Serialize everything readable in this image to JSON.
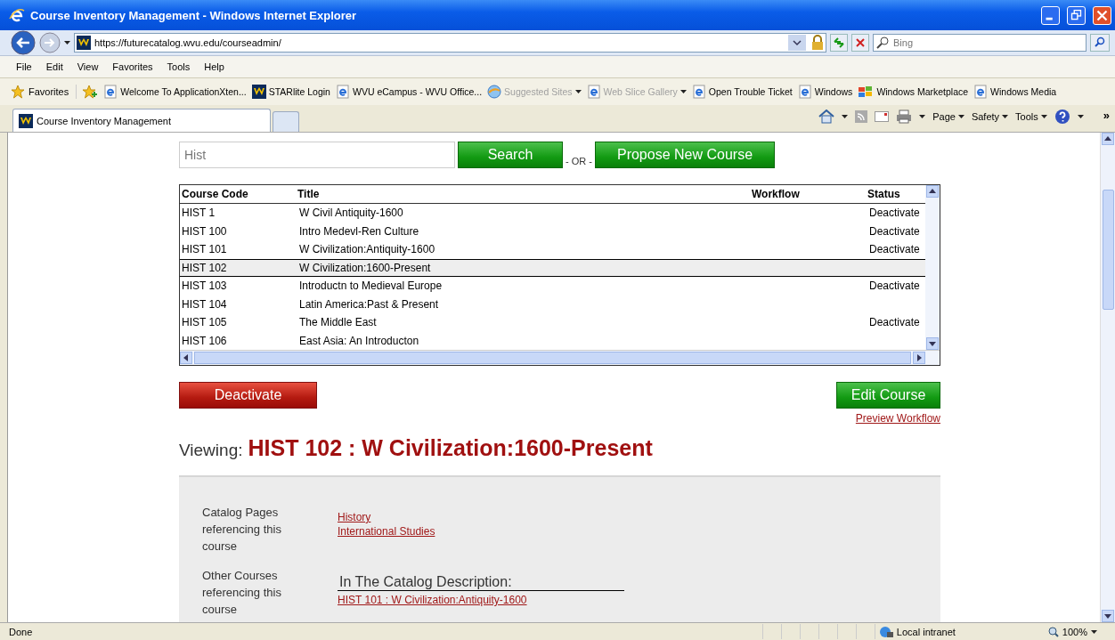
{
  "window": {
    "title": "Course Inventory Management - Windows Internet Explorer"
  },
  "address_bar": {
    "url": "https://futurecatalog.wvu.edu/courseadmin/",
    "search_placeholder": "Bing"
  },
  "menu": [
    "File",
    "Edit",
    "View",
    "Favorites",
    "Tools",
    "Help"
  ],
  "favorites_bar": {
    "label": "Favorites",
    "items": [
      {
        "label": "Welcome To ApplicationXten...",
        "kind": "page",
        "disabled": false,
        "dropdown": false
      },
      {
        "label": "STARlite Login",
        "kind": "site",
        "disabled": false,
        "dropdown": false
      },
      {
        "label": "WVU eCampus - WVU Office...",
        "kind": "page",
        "disabled": false,
        "dropdown": false
      },
      {
        "label": "Suggested Sites",
        "kind": "globe",
        "disabled": true,
        "dropdown": true
      },
      {
        "label": "Web Slice Gallery",
        "kind": "page",
        "disabled": true,
        "dropdown": true
      },
      {
        "label": "Open Trouble Ticket",
        "kind": "page",
        "disabled": false,
        "dropdown": false
      },
      {
        "label": "Windows",
        "kind": "page",
        "disabled": false,
        "dropdown": false
      },
      {
        "label": "Windows Marketplace",
        "kind": "flag",
        "disabled": false,
        "dropdown": false
      },
      {
        "label": "Windows Media",
        "kind": "page",
        "disabled": false,
        "dropdown": false
      }
    ]
  },
  "tabs": [
    {
      "label": "Course Inventory Management",
      "selected": true
    }
  ],
  "command_bar": {
    "menus": [
      "Page",
      "Safety",
      "Tools"
    ],
    "more": "»"
  },
  "search": {
    "value": "Hist",
    "button": "Search",
    "separator": "- OR -",
    "propose_button": "Propose New Course"
  },
  "table": {
    "columns": [
      "Course Code",
      "Title",
      "Workflow",
      "Status"
    ],
    "rows": [
      {
        "code": "HIST 1",
        "title": "W Civil Antiquity-1600",
        "status": "Deactivate",
        "selected": false
      },
      {
        "code": "HIST 100",
        "title": "Intro Medevl-Ren Culture",
        "status": "Deactivate",
        "selected": false
      },
      {
        "code": "HIST 101",
        "title": "W Civilization:Antiquity-1600",
        "status": "Deactivate",
        "selected": false
      },
      {
        "code": "HIST 102",
        "title": "W Civilization:1600-Present",
        "selected": true
      },
      {
        "code": "HIST 103",
        "title": "Introductn to Medieval Europe",
        "status": "Deactivate",
        "selected": false
      },
      {
        "code": "HIST 104",
        "title": "Latin America:Past & Present",
        "selected": false
      },
      {
        "code": "HIST 105",
        "title": "The Middle East",
        "status": "Deactivate",
        "selected": false
      },
      {
        "code": "HIST 106",
        "title": "East Asia: An Introducton",
        "selected": false
      }
    ]
  },
  "actions": {
    "deactivate": "Deactivate",
    "edit": "Edit Course",
    "preview": "Preview Workflow"
  },
  "viewing": {
    "label": "Viewing:",
    "title": "HIST 102 : W Civilization:1600-Present"
  },
  "references": [
    {
      "label": "Catalog Pages referencing this course",
      "links": [
        "History",
        "International Studies"
      ]
    },
    {
      "label": "Other Courses referencing this course",
      "heading": "In The Catalog Description:",
      "links": [
        "HIST 101 : W Civilization:Antiquity-1600"
      ]
    }
  ],
  "status_bar": {
    "text": "Done",
    "zone": "Local intranet",
    "zoom": "100%"
  }
}
